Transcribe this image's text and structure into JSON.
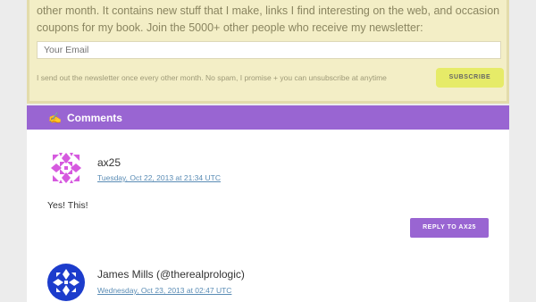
{
  "newsletter": {
    "line1": "other month. It contains new stuff that I make, links I find interesting on the web, and occasional discount",
    "line2": "coupons for my book. Join the 5000+ other people who receive my newsletter:",
    "email_placeholder": "Your Email",
    "note": "I send out the newsletter once every other month. No spam, I promise + you can unsubscribe at anytime",
    "subscribe_label": "SUBSCRIBE",
    "background_color": "#f3eec6",
    "button_color": "#e6eb68"
  },
  "comments": {
    "header_icon": "writing-hand-icon",
    "header_title": "Comments",
    "accent_color": "#9965d2",
    "items": [
      {
        "author": "ax25",
        "date": "Tuesday, Oct 22, 2013 at 21:34 UTC",
        "text": "Yes! This!",
        "reply_label": "REPLY TO AX25",
        "avatar_icon": "identicon-magenta"
      },
      {
        "author": "James Mills (@therealprologic)",
        "date": "Wednesday, Oct 23, 2013 at 02:47 UTC",
        "avatar_icon": "identicon-blue"
      }
    ]
  }
}
